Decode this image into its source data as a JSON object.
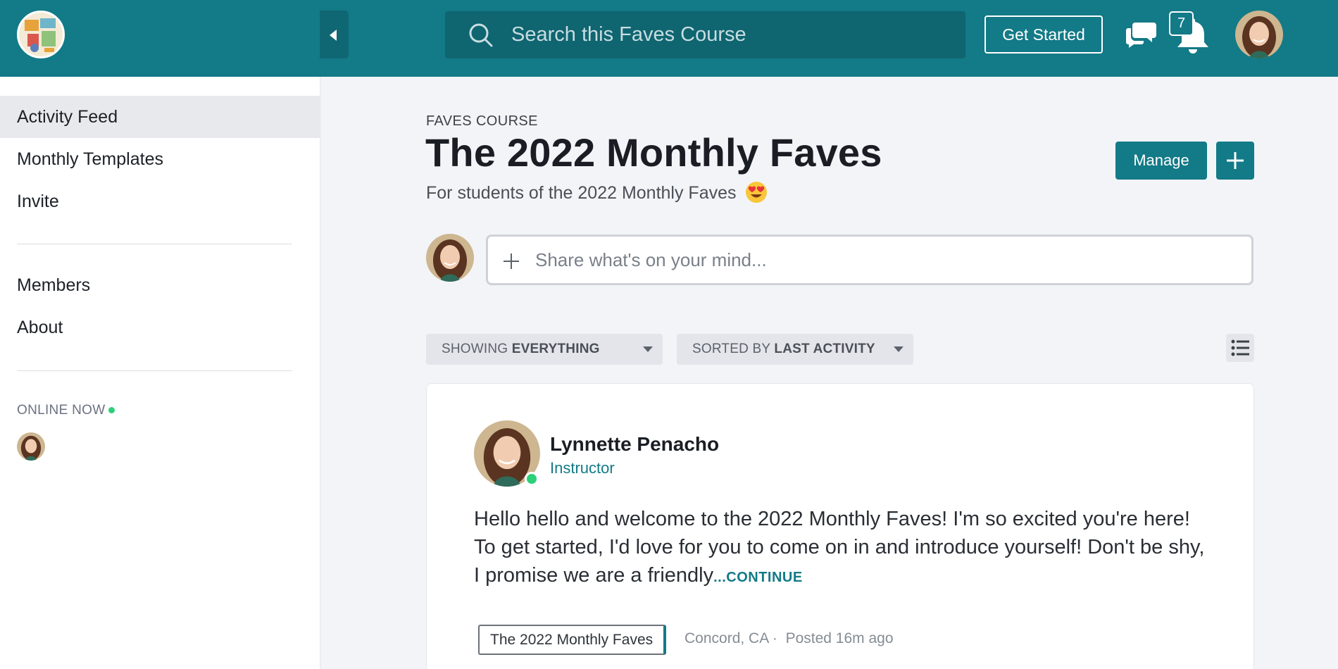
{
  "header": {
    "search_placeholder": "Search this Faves Course",
    "get_started_label": "Get Started",
    "notification_count": "7",
    "brand_color": "#137a87"
  },
  "sidebar": {
    "items": [
      {
        "label": "Activity Feed",
        "active": true
      },
      {
        "label": "Monthly Templates",
        "active": false
      },
      {
        "label": "Invite",
        "active": false
      }
    ],
    "secondary_items": [
      {
        "label": "Members"
      },
      {
        "label": "About"
      }
    ],
    "online_label": "ONLINE NOW"
  },
  "main": {
    "eyebrow": "FAVES COURSE",
    "title": "The 2022 Monthly Faves",
    "subtitle": "For students of the 2022 Monthly Faves",
    "subtitle_emoji": "heart-eyes-emoji",
    "manage_label": "Manage",
    "composer_placeholder": "Share what's on your mind...",
    "filters": {
      "showing_prefix": "SHOWING",
      "showing_value": "EVERYTHING",
      "sorted_prefix": "SORTED BY",
      "sorted_value": "LAST ACTIVITY"
    }
  },
  "post": {
    "author": "Lynnette Penacho",
    "role": "Instructor",
    "body": "Hello hello and welcome to the 2022 Monthly Faves! I'm so excited you're here! To get started, I'd love for you to come on in and introduce yourself! Don't be shy, I promise we are a friendly",
    "continue_label": "...CONTINUE",
    "tag": "The 2022 Monthly Faves",
    "location": "Concord, CA",
    "separator": "·",
    "posted": "Posted 16m ago"
  }
}
